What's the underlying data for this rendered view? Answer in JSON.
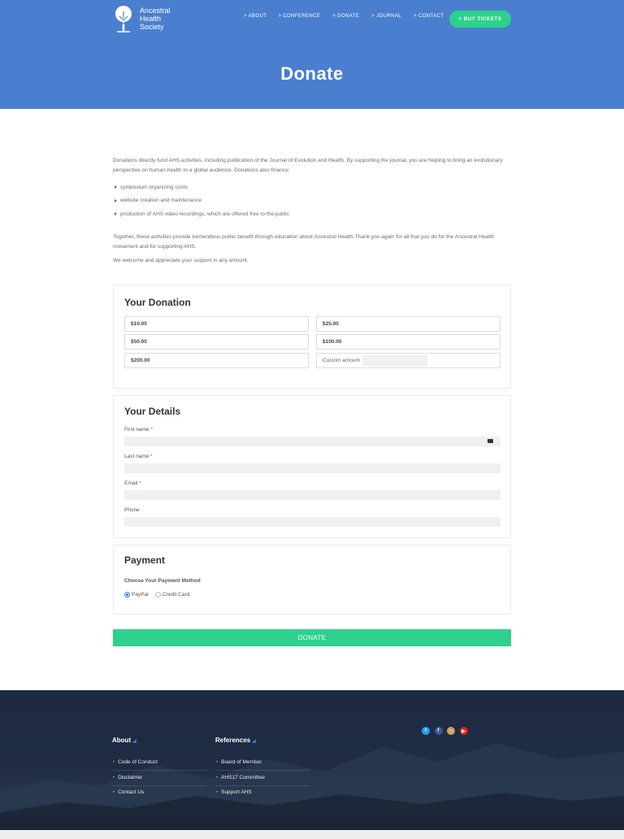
{
  "header": {
    "logo_lines": [
      "Ancestral",
      "Health",
      "Society"
    ],
    "nav": [
      "> ABOUT",
      "> CONFERENCE",
      "> DONATE",
      "> JOURNAL",
      "> CONTACT"
    ],
    "cta": "> BUY TICKETS",
    "title": "Donate"
  },
  "intro": {
    "p1": "Donations directly fund AHS activities, including publication of the Journal of Evolution and Health. By supporting the journal, you are helping to bring an evolutionary perspective on human health to a global audience. Donations also finance:",
    "bullets": [
      "symposium organizing costs",
      "website creation and maintenance",
      "production of AHS video recordings, which are offered free to the public"
    ],
    "p2": "Together, these activities provide tremendous public benefit through education about Ancestral Health.Thank you again for all that you do for the Ancestral Health movement and for supporting AHS.",
    "p3": "We welcome and appreciate your support in any amount."
  },
  "donation": {
    "title": "Your Donation",
    "amounts": [
      "$10.00",
      "$25.00",
      "$50.00",
      "$100.00",
      "$200.00"
    ],
    "custom_label": "Custom amount",
    "custom_value": ""
  },
  "details": {
    "title": "Your Details",
    "first_name": "First name",
    "last_name": "Last name",
    "email": "Email",
    "phone": "Phone",
    "required_mark": "*"
  },
  "payment": {
    "title": "Payment",
    "method_label": "Choose Your Payment Method",
    "options": [
      "PayPal",
      "Credit Card"
    ],
    "selected": "PayPal"
  },
  "donate_button": "DONATE",
  "footer": {
    "about_title": "About",
    "about_links": [
      "Code of Conduct",
      "Disclaimer",
      "Contact Us"
    ],
    "references_title": "References",
    "references_links": [
      "Board of Member",
      "AHS17 Committee",
      "Support AHS"
    ],
    "social_icons": [
      "twitter-icon",
      "facebook-icon",
      "instagram-icon",
      "youtube-icon"
    ],
    "social_colors": [
      "#1da1f2",
      "#3b5998",
      "#c8a165",
      "#e62117"
    ]
  }
}
